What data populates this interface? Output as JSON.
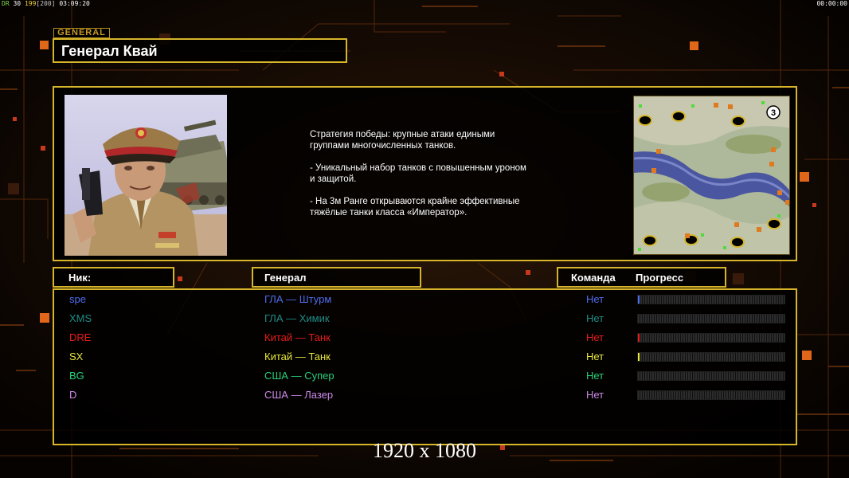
{
  "status_bar": {
    "fps_label": "DR",
    "fps_value": "30",
    "frame_value": "199",
    "frame_bracket": "[200]",
    "game_clock": "03:09:20",
    "right_clock": "00:00:00"
  },
  "general_tag": "GENERAL",
  "general_name": "Генерал Квай",
  "description": "Стратегия победы: крупные атаки едиными\n группами многочисленных танков.\n\n- Уникальный набор танков с повышенным уроном\n и защитой.\n\n- На 3м Ранге открываются крайне эффективные\n тяжёлые танки класса «Император».",
  "minimap": {
    "player_count_badge": "3"
  },
  "table_headers": {
    "nick": "Ник:",
    "general": "Генерал",
    "team": "Команда",
    "progress": "Прогресс"
  },
  "players": [
    {
      "nick": "spe",
      "general": "ГЛА — Штурм",
      "team": "Нет",
      "color": "#4f6df0",
      "progress": 0.01
    },
    {
      "nick": "XMS",
      "general": "ГЛА — Химик",
      "team": "Нет",
      "color": "#1f8c86",
      "progress": 0.0
    },
    {
      "nick": "DRE",
      "general": "Китай — Танк",
      "team": "Нет",
      "color": "#e81b1b",
      "progress": 0.01
    },
    {
      "nick": "SX",
      "general": "Китай — Танк",
      "team": "Нет",
      "color": "#e6e63a",
      "progress": 0.01
    },
    {
      "nick": "BG",
      "general": "США — Супер",
      "team": "Нет",
      "color": "#27d07a",
      "progress": 0.0
    },
    {
      "nick": "D",
      "general": "США — Лазер",
      "team": "Нет",
      "color": "#c98ae6",
      "progress": 0.0
    }
  ],
  "resolution_text": "1920 x 1080"
}
